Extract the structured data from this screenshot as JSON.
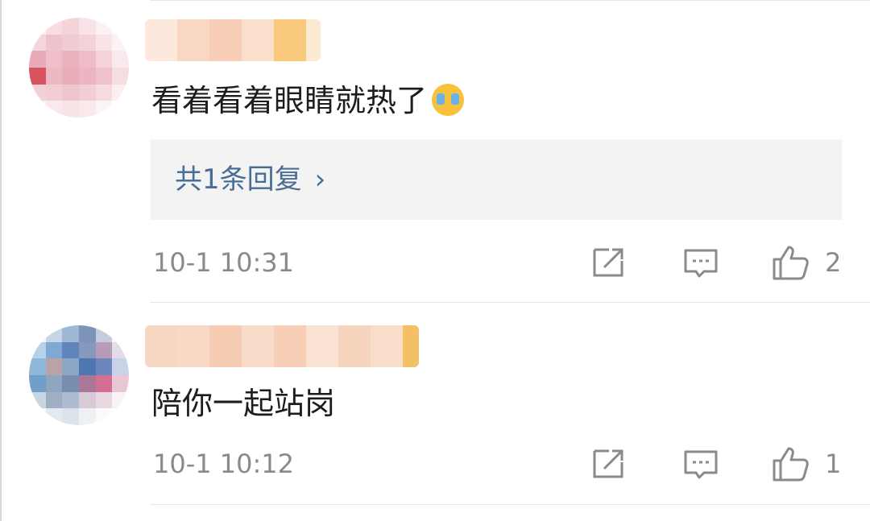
{
  "comments": [
    {
      "text": "看着看着眼睛就热了",
      "emoji": "crying-face-icon",
      "reply_link": "共1条回复",
      "time": "10-1 10:31",
      "likes": "2"
    },
    {
      "text": "陪你一起站岗",
      "time": "10-1 10:12",
      "likes": "1"
    }
  ],
  "icons": {
    "share": "share-icon",
    "comment": "comment-icon",
    "like": "like-icon"
  },
  "colors": {
    "link": "#4a6d95",
    "meta": "#8a8a8a",
    "reply_bg": "#f3f3f3"
  }
}
